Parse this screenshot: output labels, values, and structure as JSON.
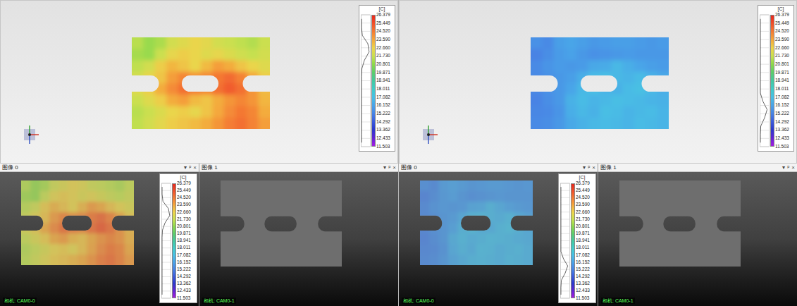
{
  "legend": {
    "unit": "[C]",
    "ticks": [
      {
        "value": "26.379",
        "color": "#e8281c"
      },
      {
        "value": "25.449",
        "color": "#f0502a"
      },
      {
        "value": "24.520",
        "color": "#f47c34"
      },
      {
        "value": "23.590",
        "color": "#f4a83c"
      },
      {
        "value": "22.660",
        "color": "#ecd44c"
      },
      {
        "value": "21.730",
        "color": "#c8e050"
      },
      {
        "value": "20.801",
        "color": "#8cd84c"
      },
      {
        "value": "19.871",
        "color": "#5ccc6c"
      },
      {
        "value": "18.941",
        "color": "#44c8a0"
      },
      {
        "value": "18.011",
        "color": "#40ccc8"
      },
      {
        "value": "17.082",
        "color": "#48c0e4"
      },
      {
        "value": "16.152",
        "color": "#4aa4e8"
      },
      {
        "value": "15.222",
        "color": "#4884e4"
      },
      {
        "value": "14.292",
        "color": "#3c5cdc"
      },
      {
        "value": "13.362",
        "color": "#2c38cc"
      },
      {
        "value": "12.433",
        "color": "#6024d4"
      },
      {
        "value": "11.503",
        "color": "#a41ce0"
      }
    ]
  },
  "views": [
    {
      "histogram": [
        0,
        0,
        0.1,
        0.75,
        0.9,
        0.35,
        0.05,
        0,
        0,
        0,
        0,
        0,
        0,
        0,
        0,
        0
      ],
      "field": [
        [
          21.5,
          21.0,
          21.3,
          22.0,
          22.3,
          22.6,
          22.4,
          22.0,
          21.8,
          21.6,
          21.4,
          21.8
        ],
        [
          21.2,
          21.0,
          21.8,
          22.5,
          22.8,
          22.6,
          22.3,
          22.5,
          22.2,
          21.9,
          21.7,
          22.0
        ],
        [
          21.6,
          22.0,
          22.8,
          23.3,
          23.0,
          22.6,
          23.2,
          23.8,
          23.5,
          23.0,
          22.6,
          22.3
        ],
        [
          22.0,
          22.5,
          23.0,
          23.8,
          24.3,
          24.0,
          24.2,
          24.6,
          24.9,
          24.4,
          23.6,
          22.8
        ],
        [
          22.3,
          22.8,
          23.5,
          24.2,
          24.8,
          24.5,
          24.3,
          24.8,
          25.2,
          24.8,
          24.0,
          23.2
        ],
        [
          21.8,
          22.3,
          22.8,
          23.5,
          23.8,
          23.2,
          23.0,
          23.5,
          24.0,
          24.3,
          24.0,
          23.3
        ],
        [
          21.5,
          21.8,
          22.2,
          22.6,
          22.8,
          22.5,
          23.0,
          23.6,
          24.2,
          24.6,
          24.3,
          23.5
        ],
        [
          21.6,
          22.0,
          22.4,
          22.8,
          23.0,
          23.2,
          23.5,
          24.0,
          24.5,
          24.8,
          24.4,
          23.8
        ]
      ],
      "panels": [
        {
          "title": "图像 0",
          "controls": [
            "▾",
            "ᵖ",
            "×"
          ],
          "camera": "相机: CAM0-0",
          "overlay": true
        },
        {
          "title": "图像 1",
          "controls": [
            "▾",
            "ᵖ",
            "×"
          ],
          "camera": "相机: CAM0-1",
          "overlay": false
        }
      ]
    },
    {
      "histogram": [
        0,
        0,
        0,
        0,
        0,
        0,
        0,
        0,
        0,
        0,
        0.3,
        0.8,
        0.5,
        0.05,
        0,
        0
      ],
      "field": [
        [
          15.6,
          15.4,
          16.0,
          16.2,
          16.0,
          15.8,
          15.9,
          16.0,
          16.0,
          15.9,
          15.8,
          15.9
        ],
        [
          15.2,
          15.5,
          15.9,
          16.1,
          15.8,
          15.6,
          15.7,
          15.8,
          15.9,
          15.8,
          15.8,
          15.8
        ],
        [
          15.4,
          15.7,
          15.9,
          15.8,
          15.9,
          16.3,
          16.4,
          16.8,
          16.5,
          16.2,
          16.0,
          15.9
        ],
        [
          15.4,
          15.6,
          15.8,
          16.0,
          16.5,
          16.9,
          17.0,
          16.8,
          16.7,
          16.9,
          16.6,
          16.3
        ],
        [
          15.3,
          15.6,
          15.8,
          16.2,
          16.8,
          17.0,
          16.7,
          16.6,
          16.9,
          17.1,
          16.8,
          16.5
        ],
        [
          15.2,
          15.5,
          15.8,
          16.6,
          16.9,
          16.7,
          16.8,
          17.0,
          16.9,
          16.8,
          16.7,
          16.6
        ],
        [
          15.3,
          15.4,
          15.7,
          16.5,
          16.8,
          16.6,
          17.0,
          16.9,
          16.7,
          16.8,
          16.9,
          16.7
        ],
        [
          15.4,
          15.5,
          15.8,
          16.3,
          16.6,
          16.8,
          16.9,
          16.8,
          16.7,
          16.9,
          16.8,
          16.7
        ]
      ],
      "panels": [
        {
          "title": "图像 0",
          "controls": [
            "▾",
            "ᵖ",
            "×"
          ],
          "camera": "相机: CAM0-0",
          "overlay": true
        },
        {
          "title": "图像 1",
          "controls": [
            "▾",
            "ᵖ",
            "×"
          ],
          "camera": "相机: CAM0-1",
          "overlay": false
        }
      ]
    }
  ]
}
